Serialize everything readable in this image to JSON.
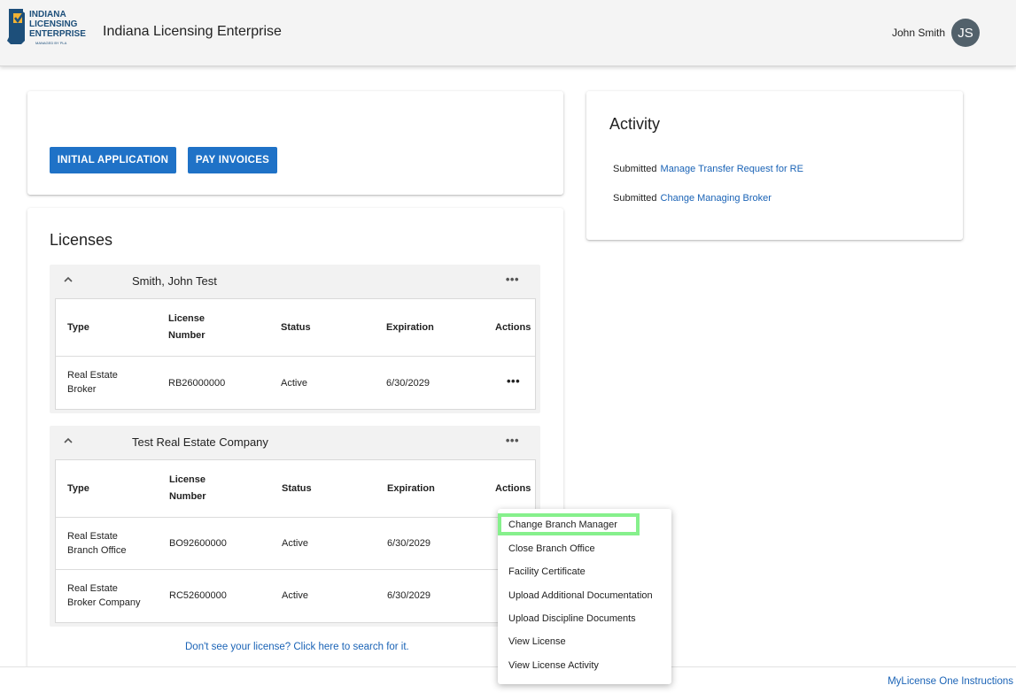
{
  "header": {
    "logo_lines": [
      "INDIANA",
      "LICENSING",
      "ENTERPRISE"
    ],
    "logo_tag": "MANAGED BY PLA",
    "title": "Indiana Licensing Enterprise",
    "user_name": "John Smith",
    "user_initials": "JS"
  },
  "actions": {
    "initial_application": "INITIAL APPLICATION",
    "pay_invoices": "PAY INVOICES"
  },
  "licenses": {
    "title": "Licenses",
    "columns": {
      "type": "Type",
      "number_line1": "License",
      "number_line2": "Number",
      "status": "Status",
      "expiration": "Expiration",
      "actions": "Actions"
    },
    "groups": [
      {
        "name": "Smith, John Test",
        "rows": [
          {
            "type_line1": "Real Estate",
            "type_line2": "Broker",
            "number": "RB26000000",
            "status": "Active",
            "expiration": "6/30/2029"
          }
        ]
      },
      {
        "name": "Test Real Estate Company",
        "rows": [
          {
            "type_line1": "Real Estate",
            "type_line2": "Branch Office",
            "number": "BO92600000",
            "status": "Active",
            "expiration": "6/30/2029"
          },
          {
            "type_line1": "Real Estate",
            "type_line2": "Broker Company",
            "number": "RC52600000",
            "status": "Active",
            "expiration": "6/30/2029"
          }
        ]
      }
    ],
    "search_link": "Don't see your license? Click here to search for it."
  },
  "activity": {
    "title": "Activity",
    "items": [
      {
        "prefix": "Submitted",
        "link": "Manage Transfer Request for RE"
      },
      {
        "prefix": "Submitted",
        "link": "Change Managing Broker"
      }
    ]
  },
  "menu": {
    "items": [
      "Change Branch Manager",
      "Close Branch Office",
      "Facility Certificate",
      "Upload Additional Documentation",
      "Upload Discipline Documents",
      "View License",
      "View License Activity"
    ]
  },
  "footer": {
    "link": "MyLicense One Instructions"
  },
  "colors": {
    "primary_button": "#1f72c7",
    "link": "#1a63b6",
    "highlight": "#86f08c",
    "avatar": "#52616b"
  }
}
